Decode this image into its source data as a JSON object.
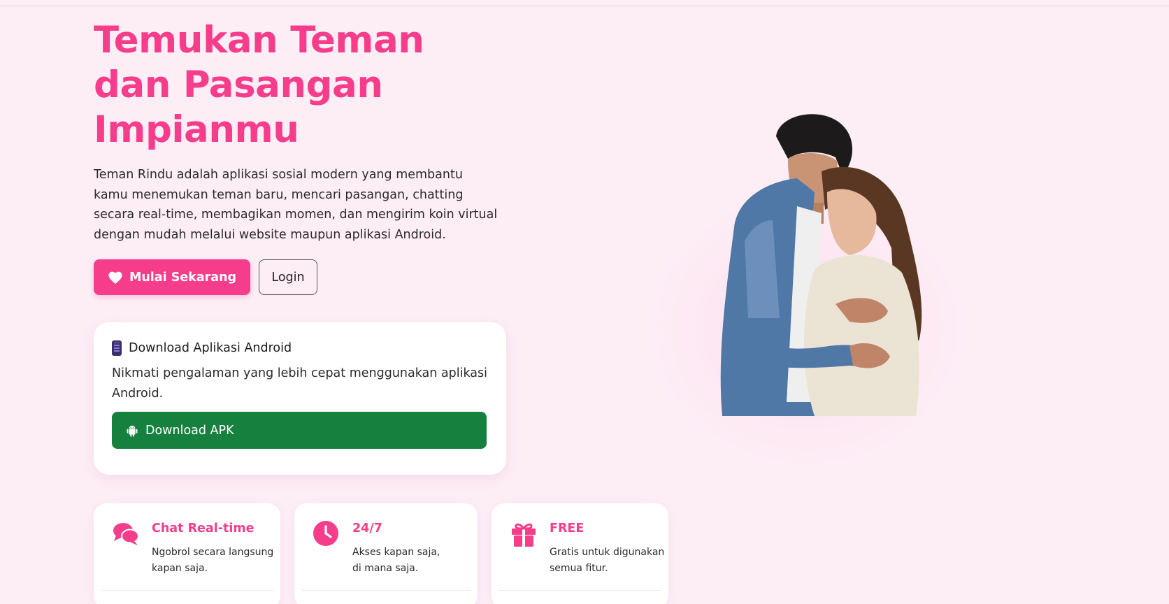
{
  "hero": {
    "title_line1": "Temukan Teman",
    "title_line2": "dan Pasangan",
    "title_line3": "Impianmu",
    "description": "Teman Rindu adalah aplikasi sosial modern yang membantu kamu menemukan teman baru, mencari pasangan, chatting secara real-time, membagikan momen, dan mengirim koin virtual dengan mudah melalui website maupun aplikasi Android.",
    "cta_label": "Mulai Sekarang",
    "login_label": "Login"
  },
  "download": {
    "heading": "Download Aplikasi Android",
    "text": "Nikmati pengalaman yang lebih cepat menggunakan aplikasi Android.",
    "button_label": "Download APK"
  },
  "features": [
    {
      "icon": "chat-bubbles-icon",
      "title": "Chat Real-time",
      "desc": "Ngobrol secara langsung\nkapan saja."
    },
    {
      "icon": "clock-icon",
      "title": "24/7",
      "desc": "Akses kapan saja,\ndi mana saja."
    },
    {
      "icon": "gift-icon",
      "title": "FREE",
      "desc": "Gratis untuk digunakan\nsemua fitur."
    }
  ],
  "colors": {
    "accent": "#f53d8b",
    "background": "#fdeef6",
    "download_green": "#16803f"
  }
}
